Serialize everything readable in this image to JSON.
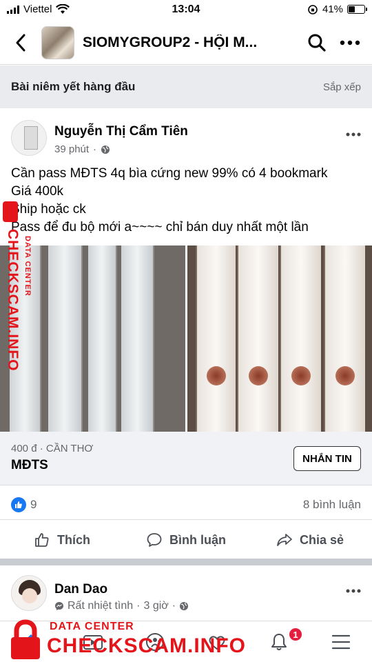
{
  "status_bar": {
    "carrier": "Viettel",
    "time": "13:04",
    "battery": "41%",
    "battery_level": 0.41
  },
  "nav": {
    "title": "SIOMYGROUP2 - HỘI M...",
    "back_icon": "chevron-left-icon",
    "search_icon": "search-icon",
    "more_icon": "more-horizontal-icon"
  },
  "section": {
    "title": "Bài niêm yết hàng đầu",
    "sort_label": "Sắp xếp"
  },
  "post": {
    "author": "Nguyễn Thị Cẩm Tiên",
    "time": "39 phút",
    "privacy_icon": "globe-icon",
    "text_lines": [
      "Cần pass MĐTS 4q bìa cứng new 99% có 4 bookmark",
      "Giá 400k",
      "Ship hoặc ck",
      "Pass để đu bộ mới a~~~~ chỉ bán duy nhất một lần"
    ],
    "listing": {
      "price_location": "400 đ · CẦN THƠ",
      "title": "MĐTS",
      "message_button": "NHẮN TIN"
    },
    "likes_count": "9",
    "comments_count": "8 bình luận",
    "actions": {
      "like": "Thích",
      "comment": "Bình luận",
      "share": "Chia sẻ"
    }
  },
  "post2": {
    "author": "Dan Dao",
    "badge": "Rất nhiệt tình",
    "time": "3 giờ"
  },
  "tab_bar": {
    "notifications_badge": "1"
  },
  "watermark": {
    "vertical_main": "CHECKSCAM.INFO",
    "vertical_small": "DATA CENTER",
    "bottom_small": "DATA CENTER",
    "bottom_big": "CHECKSCAM.INFO"
  },
  "colors": {
    "accent": "#1877f2",
    "watermark": "#e4141b",
    "badge": "#e41e3f"
  }
}
